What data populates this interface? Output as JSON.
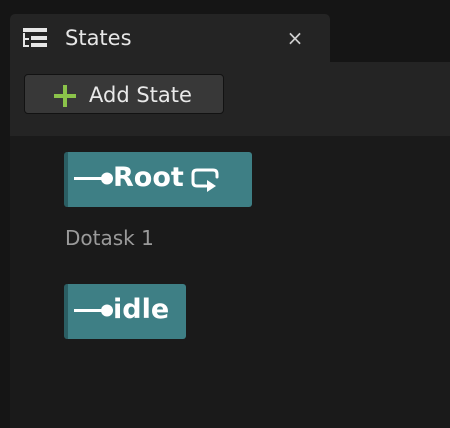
{
  "panel": {
    "tab_title": "States",
    "tab_icon": "tree-list-icon",
    "close_icon": "close-icon",
    "close_glyph": "×"
  },
  "toolbar": {
    "add_state_label": "Add State",
    "add_state_icon": "plus-icon"
  },
  "tree": {
    "states": [
      {
        "label": "Root",
        "icons": [
          "entry-arrow-icon",
          "loop-icon"
        ],
        "tasks": [
          "Dotask 1"
        ]
      },
      {
        "label": "idle",
        "icons": [
          "entry-arrow-icon"
        ],
        "tasks": []
      }
    ]
  },
  "colors": {
    "background": "#151515",
    "panel": "#242424",
    "tree_background": "#1a1a1a",
    "button": "#383838",
    "state_node": "#3e7f85",
    "state_node_accent": "#2b5e63",
    "plus_icon": "#8bc34a",
    "text_primary": "#e6e6e6",
    "text_secondary": "#9a9a9a"
  }
}
